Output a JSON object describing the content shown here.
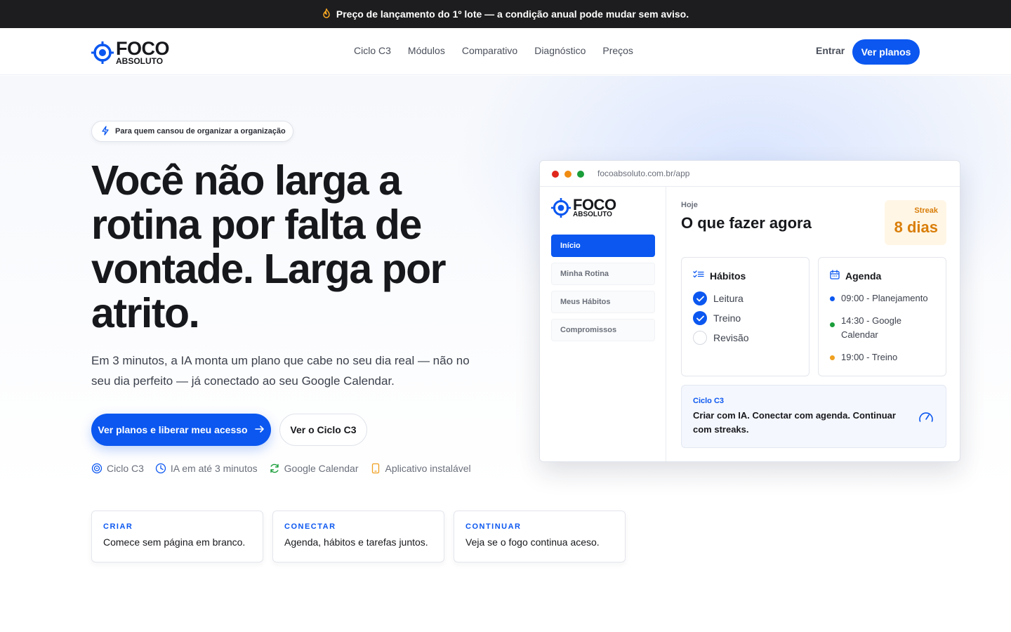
{
  "announcement": {
    "icon": "fire-icon",
    "text": "Preço de lançamento do 1º lote — a condição anual pode mudar sem aviso."
  },
  "brand": {
    "name_top": "FOCO",
    "name_bottom": "ABSOLUTO",
    "accent": "#0b57f0"
  },
  "nav": {
    "links": [
      "Ciclo C3",
      "Módulos",
      "Comparativo",
      "Diagnóstico",
      "Preços"
    ],
    "login": "Entrar",
    "cta": "Ver planos"
  },
  "hero": {
    "eyebrow": "Para quem cansou de organizar a organização",
    "title": "Você não larga a rotina por falta de vontade. Larga por atrito.",
    "lead": "Em 3 minutos, a IA monta um plano que cabe no seu dia real — não no seu dia perfeito — já conectado ao seu Google Calendar.",
    "primary_cta": "Ver planos e liberar meu acesso",
    "secondary_cta": "Ver o Ciclo C3",
    "features": [
      {
        "icon": "target-icon",
        "label": "Ciclo C3"
      },
      {
        "icon": "clock-icon",
        "label": "IA em até 3 minutos"
      },
      {
        "icon": "sync-icon",
        "label": "Google Calendar"
      },
      {
        "icon": "phone-icon",
        "label": "Aplicativo instalável"
      }
    ],
    "cards": [
      {
        "kicker": "CRIAR",
        "text": "Comece sem página em branco."
      },
      {
        "kicker": "CONECTAR",
        "text": "Agenda, hábitos e tarefas juntos."
      },
      {
        "kicker": "CONTINUAR",
        "text": "Veja se o fogo continua aceso."
      }
    ]
  },
  "app": {
    "url": "focoabsoluto.com.br/app",
    "menu": [
      "Início",
      "Minha Rotina",
      "Meus Hábitos",
      "Compromissos"
    ],
    "active_menu": "Início",
    "today_label": "Hoje",
    "heading": "O que fazer agora",
    "streak": {
      "label": "Streak",
      "value": "8 dias",
      "color": "#d97e0a"
    },
    "habits": {
      "title": "Hábitos",
      "items": [
        {
          "label": "Leitura",
          "done": true
        },
        {
          "label": "Treino",
          "done": true
        },
        {
          "label": "Revisão",
          "done": false
        }
      ]
    },
    "agenda": {
      "title": "Agenda",
      "items": [
        {
          "text": "09:00 - Planejamento",
          "color": "#0b57f0"
        },
        {
          "text": "14:30 - Google Calendar",
          "color": "#1a9e3a"
        },
        {
          "text": "19:00 - Treino",
          "color": "#f0a020"
        }
      ]
    },
    "cycle": {
      "title": "Ciclo C3",
      "text": "Criar com IA. Conectar com agenda. Continuar com streaks."
    }
  }
}
